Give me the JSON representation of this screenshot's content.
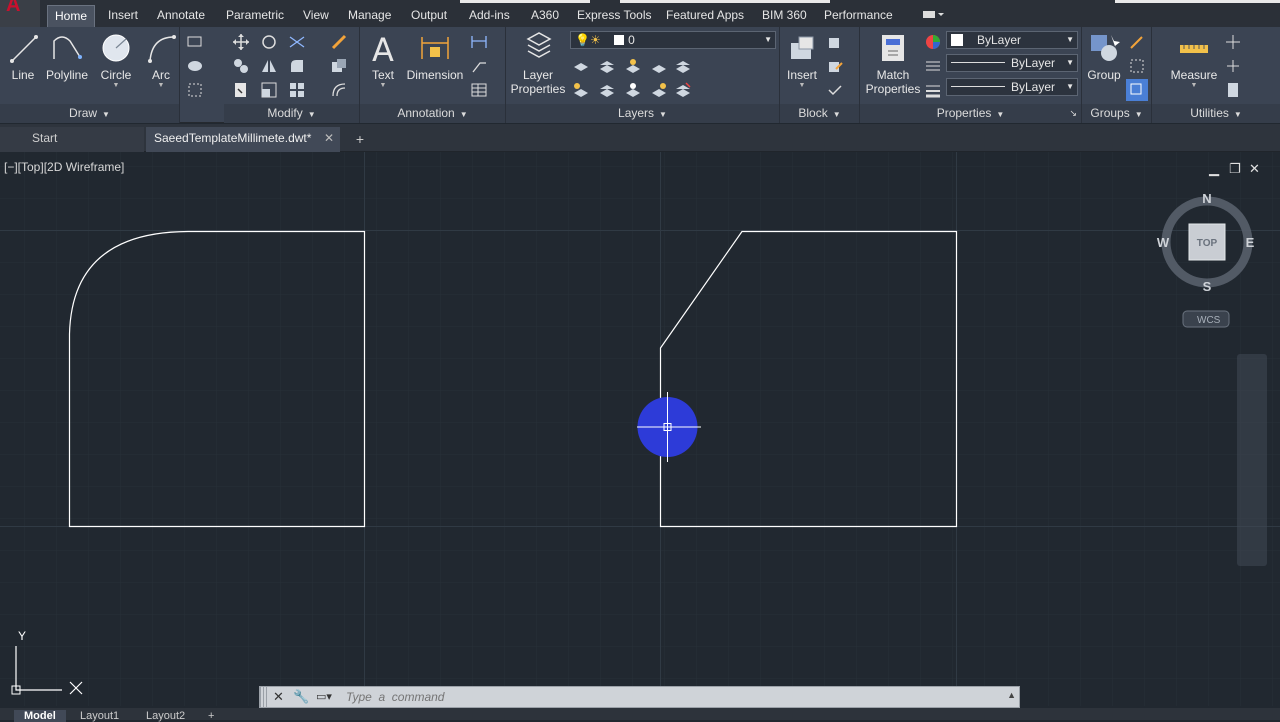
{
  "ribbon_tabs": [
    "Home",
    "Insert",
    "Annotate",
    "Parametric",
    "View",
    "Manage",
    "Output",
    "Add-ins",
    "A360",
    "Express Tools",
    "Featured Apps",
    "BIM 360",
    "Performance"
  ],
  "active_tab": "Home",
  "panels": {
    "draw": {
      "title": "Draw",
      "tools": [
        "Line",
        "Polyline",
        "Circle",
        "Arc"
      ]
    },
    "modify": {
      "title": "Modify"
    },
    "annotation": {
      "title": "Annotation",
      "tools": [
        "Text",
        "Dimension"
      ]
    },
    "layers": {
      "title": "Layers",
      "layer_properties": "Layer Properties",
      "current_layer": "0"
    },
    "block": {
      "title": "Block",
      "insert": "Insert"
    },
    "properties": {
      "title": "Properties",
      "match": "Match Properties",
      "color": "ByLayer",
      "linetype": "ByLayer",
      "lineweight": "ByLayer"
    },
    "groups": {
      "title": "Groups",
      "group": "Group"
    },
    "utilities": {
      "title": "Utilities",
      "measure": "Measure"
    }
  },
  "file_tabs": {
    "start": "Start",
    "current": "SaeedTemplateMillimete.dwt*"
  },
  "viewport": {
    "label": "[−][Top][2D Wireframe]",
    "compass": {
      "n": "N",
      "s": "S",
      "e": "E",
      "w": "W",
      "top": "TOP",
      "wcs": "WCS"
    },
    "ucs": {
      "y": "Y"
    }
  },
  "command_line": {
    "placeholder": "Type  a  command"
  },
  "layout_tabs": [
    "Model",
    "Layout1",
    "Layout2"
  ],
  "colors": {
    "accent_blue": "#2d3bd8",
    "ribbon_bg": "#3b4453",
    "viewport_bg": "#212830"
  }
}
